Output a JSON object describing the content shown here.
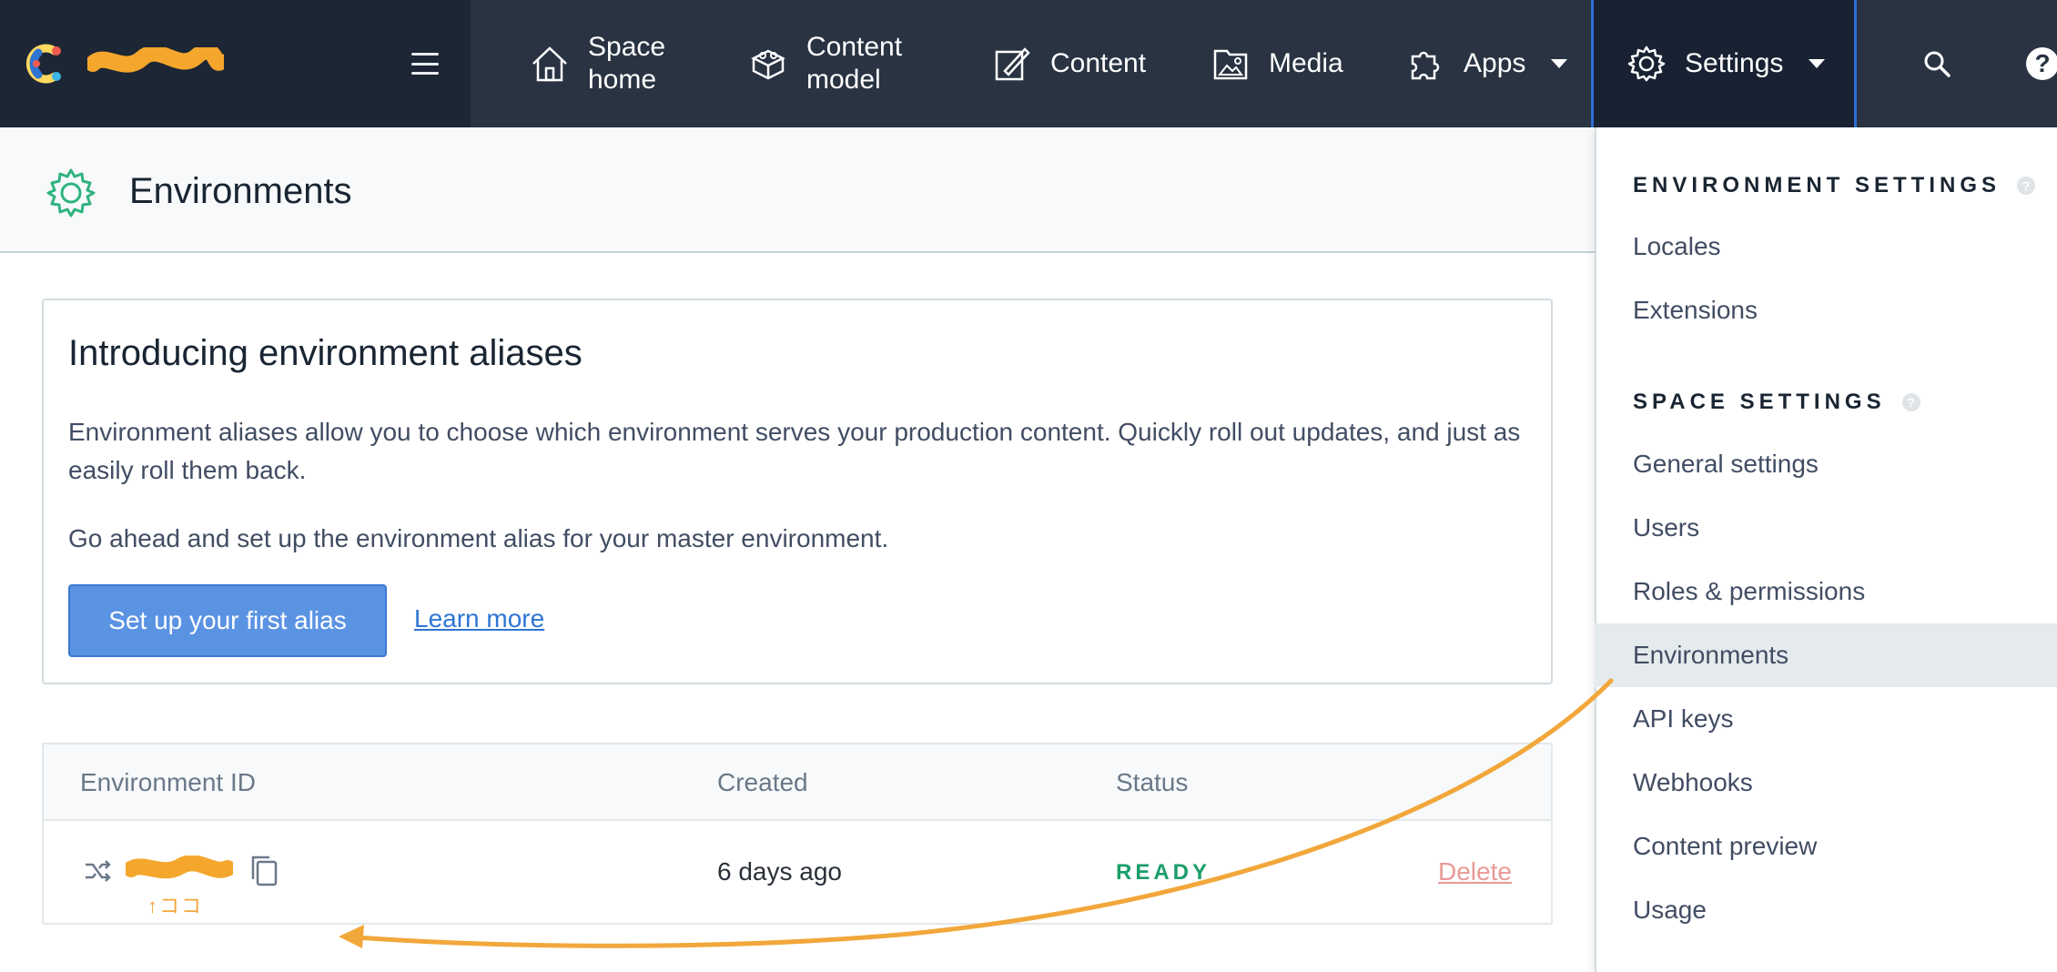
{
  "nav": {
    "space_home": "Space\nhome",
    "content_model": "Content\nmodel",
    "content": "Content",
    "media": "Media",
    "apps": "Apps",
    "settings": "Settings"
  },
  "colors": {
    "nav_bg": "#2a3342",
    "nav_left_bg": "#1d2634",
    "accent_blue": "#5b93e3",
    "status_ready": "#1a9e6a",
    "delete_link": "#e89a97",
    "annotation_orange": "#f2a73b"
  },
  "icons": [
    "hamburger-icon",
    "home-icon",
    "content-model-icon",
    "content-icon",
    "media-icon",
    "apps-icon",
    "settings-gear-icon",
    "search-icon",
    "help-icon",
    "environments-gear-icon",
    "alias-icon",
    "copy-icon"
  ],
  "page": {
    "title": "Environments"
  },
  "alias_card": {
    "title": "Introducing environment aliases",
    "description": "Environment aliases allow you to choose which environment serves your production content. Quickly roll out updates, and just as easily roll them back.",
    "prompt": "Go ahead and set up the environment alias for your master environment.",
    "button": "Set up your first alias",
    "learn_more": "Learn more"
  },
  "table": {
    "headers": [
      "Environment ID",
      "Created",
      "Status"
    ],
    "rows": [
      {
        "created": "6 days ago",
        "status": "READY",
        "action": "Delete",
        "annotation": "↑ココ"
      }
    ]
  },
  "dropdown": {
    "environment_settings": "ENVIRONMENT SETTINGS",
    "environment_items": [
      "Locales",
      "Extensions"
    ],
    "space_settings": "SPACE SETTINGS",
    "space_items": [
      "General settings",
      "Users",
      "Roles & permissions",
      "Environments",
      "API keys",
      "Webhooks",
      "Content preview",
      "Usage"
    ],
    "active_item": "Environments",
    "help_glyph": "?"
  }
}
